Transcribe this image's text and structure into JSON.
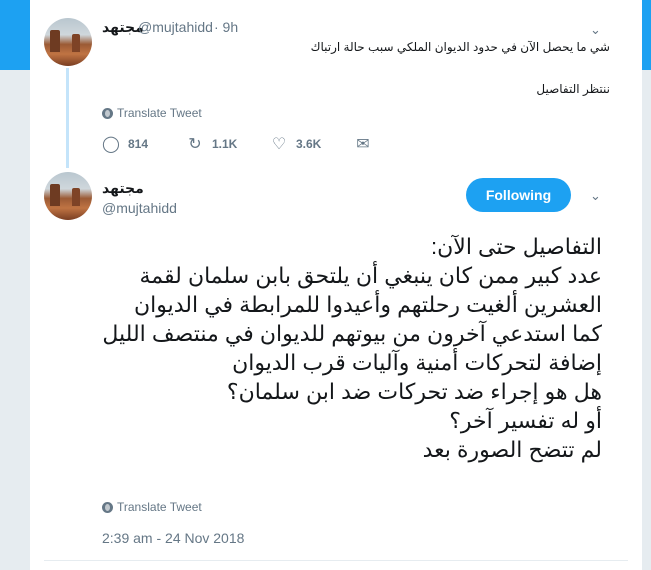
{
  "tweet1": {
    "name": "مجتهد",
    "handle": "@mujtahidd",
    "time": "· 9h",
    "line1": "شي ما يحصل الآن في حدود الديوان الملكي سبب حالة ارتباك",
    "line2": "ننتظر التفاصيل",
    "translate": "Translate Tweet",
    "replies": "814",
    "retweets": "1.1K",
    "likes": "3.6K"
  },
  "tweet2": {
    "name": "مجتهد",
    "handle": "@mujtahidd",
    "follow_label": "Following",
    "lines": [
      "التفاصيل حتى الآن:",
      "عدد كبير ممن كان ينبغي أن يلتحق بابن سلمان لقمة",
      "العشرين ألغيت رحلتهم وأعيدوا للمرابطة في الديوان",
      "كما استدعي آخرون من بيوتهم للديوان في منتصف الليل",
      "إضافة لتحركات أمنية وآليات قرب الديوان",
      "هل هو إجراء ضد تحركات ضد ابن سلمان؟",
      "أو له تفسير آخر؟",
      "لم تتضح الصورة بعد"
    ],
    "translate": "Translate Tweet",
    "timestamp": "2:39 am - 24 Nov 2018"
  },
  "icons": {
    "reply": "reply-icon",
    "retweet": "retweet-icon",
    "like": "heart-icon",
    "dm": "mail-icon",
    "chevron": "chevron-down-icon",
    "translate": "globe-icon"
  },
  "colors": {
    "accent": "#1da1f2",
    "muted": "#657786",
    "text": "#14171a"
  }
}
